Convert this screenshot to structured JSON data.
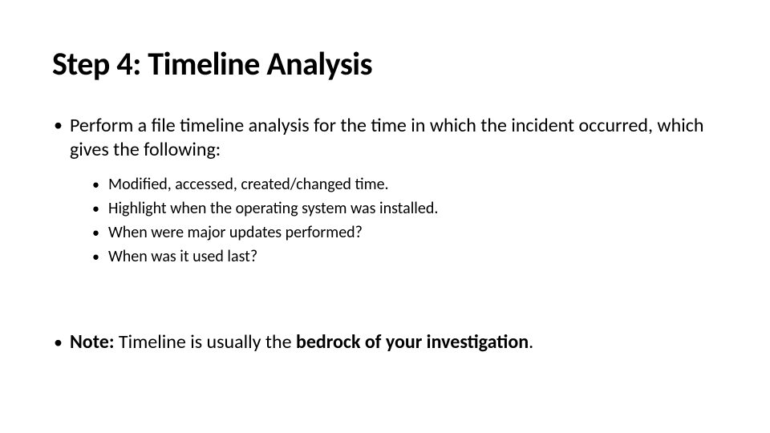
{
  "title": "Step 4: Timeline Analysis",
  "intro": "Perform a file timeline analysis for the time in which the incident occurred, which gives the following:",
  "sub": {
    "a": "Modified, accessed, created/changed time.",
    "b": "Highlight when the operating system was installed.",
    "c": "When were major updates performed?",
    "d": "When was it used last?"
  },
  "note": {
    "label": "Note:",
    "prefix": " Timeline is usually the ",
    "emph": "bedrock of your investigation",
    "suffix": "."
  }
}
